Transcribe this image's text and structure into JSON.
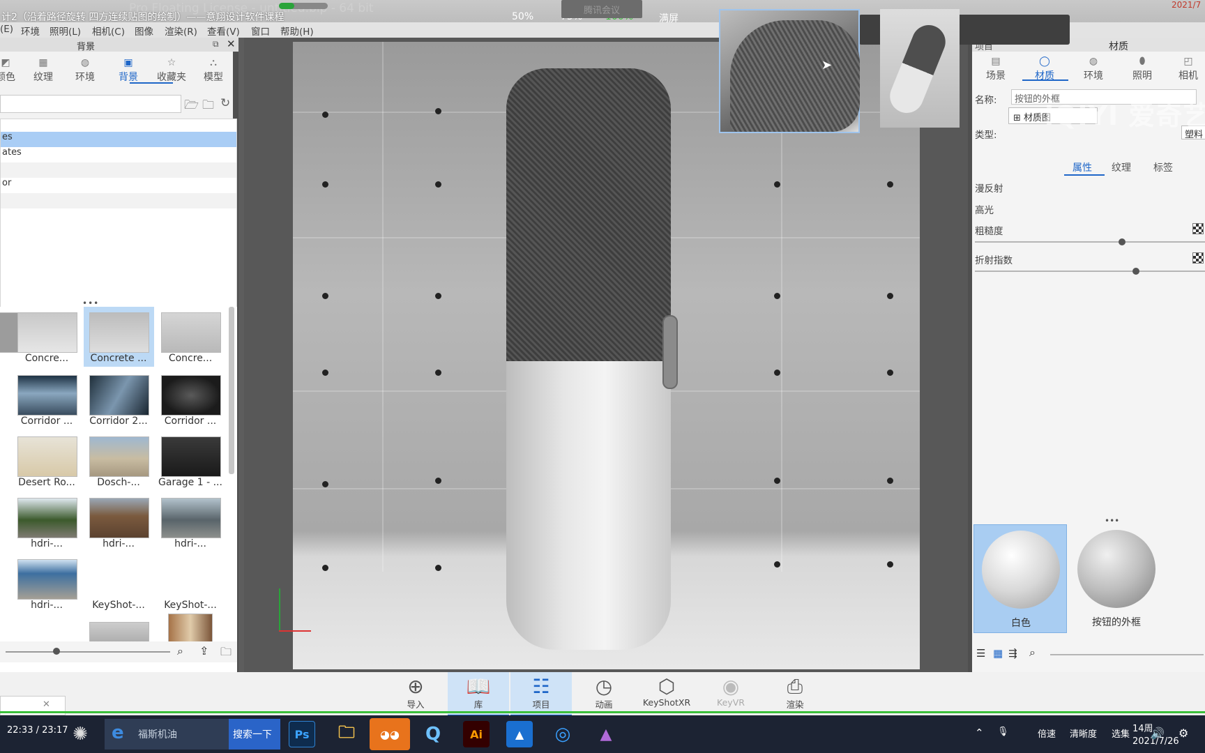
{
  "title": {
    "text": "计2（沿着路径旋转 四方连续贴图的绘制）——意翔设计软件课程",
    "faded": "Pro Floating License - untitled.bip - 64 bit",
    "zoom_options": [
      "50%",
      "75%",
      "100%",
      "满屏"
    ],
    "meeting": "腾讯会议",
    "date_corner": "2021/7"
  },
  "menu": [
    "(E)",
    "环境",
    "照明(L)",
    "相机(C)",
    "图像",
    "渲染(R)",
    "查看(V)",
    "窗口",
    "帮助(H)"
  ],
  "left_panel": {
    "title": "背景",
    "tabs": [
      {
        "label": "颜色",
        "icon": "paint-icon"
      },
      {
        "label": "纹理",
        "icon": "texture-icon"
      },
      {
        "label": "环境",
        "icon": "globe-icon"
      },
      {
        "label": "背景",
        "icon": "image-icon"
      },
      {
        "label": "收藏夹",
        "icon": "star-icon"
      },
      {
        "label": "模型",
        "icon": "model-icon"
      }
    ],
    "search_placeholder": "",
    "tree": [
      "es",
      "ates",
      "",
      "or",
      ""
    ],
    "thumbs": [
      [
        "Concre...",
        "Concrete ...",
        "Concre..."
      ],
      [
        "Corridor ...",
        "Corridor 2...",
        "Corridor ..."
      ],
      [
        "Desert Ro...",
        "Dosch-...",
        "Garage 1 - ..."
      ],
      [
        "hdri-...",
        "hdri-...",
        "hdri-..."
      ],
      [
        "hdri-...",
        "KeyShot-...",
        "KeyShot-..."
      ]
    ]
  },
  "right_panel": {
    "header_left": "项目",
    "title": "材质",
    "tabs": [
      {
        "label": "场景",
        "icon": "scene-icon"
      },
      {
        "label": "材质",
        "icon": "material-icon"
      },
      {
        "label": "环境",
        "icon": "globe-icon"
      },
      {
        "label": "照明",
        "icon": "light-icon"
      },
      {
        "label": "相机",
        "icon": "camera-icon"
      }
    ],
    "name_label": "名称:",
    "name_value": "按钮的外框",
    "material_graph_button": "材质图",
    "type_label": "类型:",
    "type_value": "塑料",
    "subtabs": [
      "属性",
      "纹理",
      "标签"
    ],
    "properties": [
      "漫反射",
      "高光",
      "粗糙度",
      "折射指数"
    ],
    "materials": [
      "白色",
      "按钮的外框"
    ]
  },
  "watermark": "iQIYI 爱奇艺",
  "bottom_toolbar": [
    {
      "label": "导入",
      "icon": "import-icon"
    },
    {
      "label": "库",
      "icon": "book-icon"
    },
    {
      "label": "项目",
      "icon": "project-icon"
    },
    {
      "label": "动画",
      "icon": "animation-icon"
    },
    {
      "label": "KeyShotXR",
      "icon": "xr-icon"
    },
    {
      "label": "KeyVR",
      "icon": "vr-icon"
    },
    {
      "label": "渲染",
      "icon": "render-icon"
    }
  ],
  "video": {
    "time": "22:33 / 23:17"
  },
  "taskbar": {
    "search_text": "福斯机油",
    "search_button": "搜索一下",
    "sys_items": [
      "倍速",
      "清晰度",
      "选集"
    ],
    "clock": "14周",
    "date": "2021/7/26"
  }
}
